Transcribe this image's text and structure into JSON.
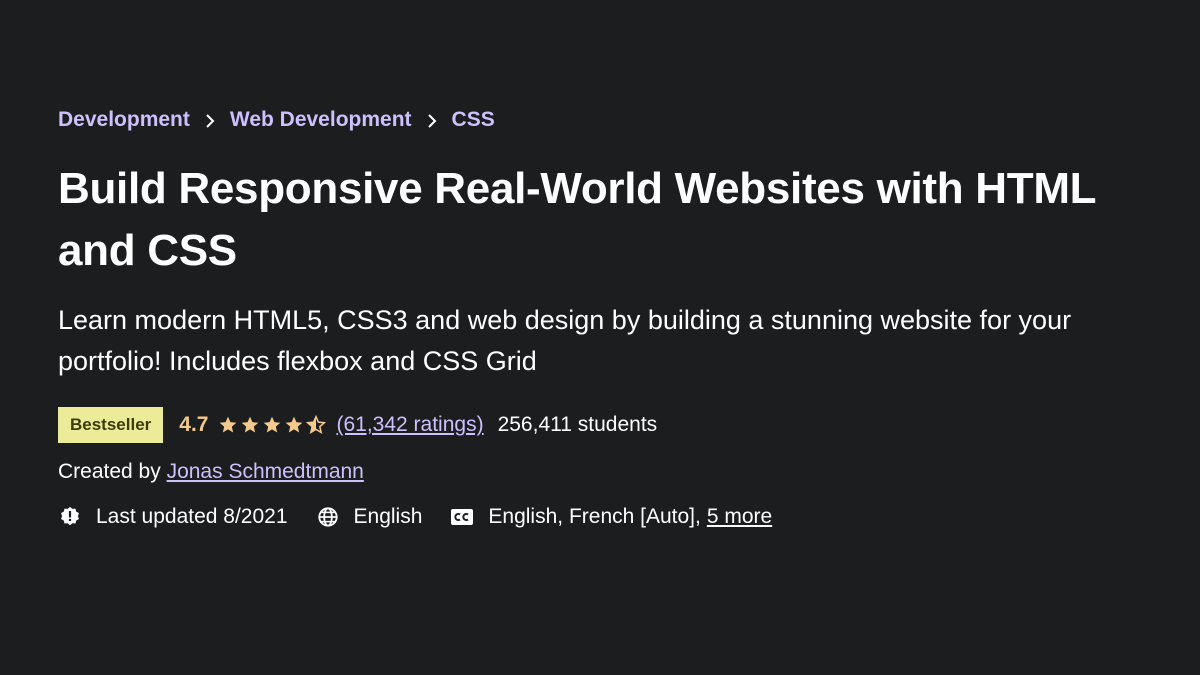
{
  "breadcrumb": {
    "items": [
      "Development",
      "Web Development",
      "CSS"
    ]
  },
  "course": {
    "title": "Build Responsive Real-World Websites with HTML and CSS",
    "subtitle": "Learn modern HTML5, CSS3 and web design by building a stunning website for your portfolio! Includes flexbox and CSS Grid"
  },
  "stats": {
    "badge": "Bestseller",
    "rating": "4.7",
    "rating_value": 4.7,
    "rating_max": 5,
    "ratings_count": "(61,342 ratings)",
    "students": "256,411 students"
  },
  "creator": {
    "prefix": "Created by",
    "name": "Jonas Schmedtmann"
  },
  "meta": {
    "last_updated": "Last updated 8/2021",
    "language": "English",
    "captions": "English, French [Auto],",
    "captions_more": "5 more"
  },
  "colors": {
    "background": "#1c1d1f",
    "link": "#cec0fc",
    "star": "#f3ca8c",
    "badge_bg": "#eceb98",
    "badge_text": "#3d3c0a"
  },
  "icons": {
    "last_updated": "alert-badge-icon",
    "language": "globe-icon",
    "captions": "closed-captions-icon",
    "separator": "chevron-right-icon",
    "star_full": "star-icon",
    "star_half": "star-half-icon"
  }
}
